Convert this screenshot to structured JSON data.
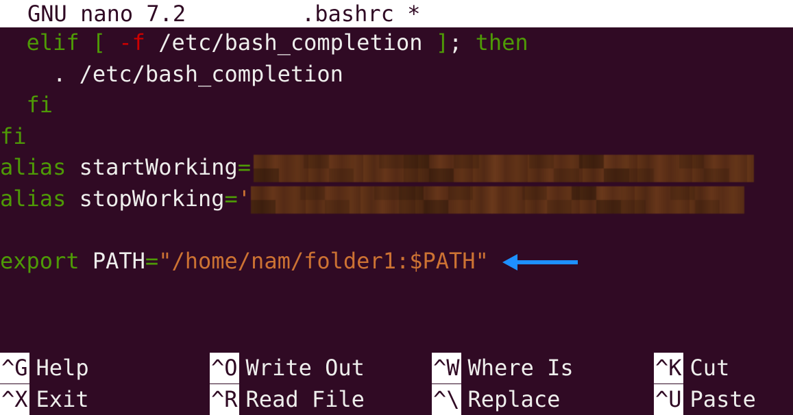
{
  "titlebar": {
    "app": "GNU nano 7.2",
    "filename": ".bashrc *"
  },
  "content": {
    "line1_elif": "elif",
    "line1_bracket_open": "[",
    "line1_flag": "-f",
    "line1_path": "/etc/bash_completion",
    "line1_bracket_close": "]",
    "line1_semicolon": ";",
    "line1_then": "then",
    "line2": "    . /etc/bash_completion",
    "line3_fi": "fi",
    "line4_fi": "fi",
    "line5_alias": "alias",
    "line5_name": " startWorking",
    "line5_eq": "=",
    "line6_alias": "alias",
    "line6_name": " stopWorking",
    "line6_eq": "=",
    "line6_quote": "'",
    "line8_export": "export",
    "line8_var": " PATH",
    "line8_eq": "=",
    "line8_value": "\"/home/nam/folder1:$PATH\""
  },
  "shortcuts": {
    "row1": [
      {
        "key": "^G",
        "label": "Help"
      },
      {
        "key": "^O",
        "label": "Write Out"
      },
      {
        "key": "^W",
        "label": "Where Is"
      },
      {
        "key": "^K",
        "label": "Cut"
      }
    ],
    "row2": [
      {
        "key": "^X",
        "label": "Exit"
      },
      {
        "key": "^R",
        "label": "Read File"
      },
      {
        "key": "^\\",
        "label": "Replace"
      },
      {
        "key": "^U",
        "label": "Paste"
      }
    ]
  },
  "annotation": {
    "arrow_color": "#1e90ff"
  }
}
